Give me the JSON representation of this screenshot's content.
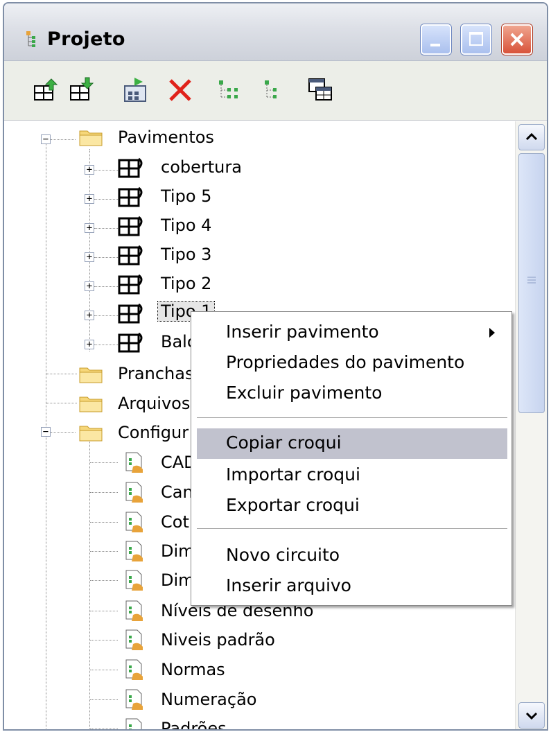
{
  "window": {
    "title": "Projeto",
    "controls": [
      "minimize",
      "maximize",
      "close"
    ]
  },
  "toolbar": {
    "icons": [
      "insert-floor-above-icon",
      "insert-floor-below-icon",
      "properties-icon",
      "delete-icon",
      "expand-tree-icon",
      "collapse-tree-icon",
      "copy-window-icon"
    ]
  },
  "tree": {
    "root_folders": {
      "pavimentos": "Pavimentos",
      "pranchas": "Pranchas",
      "arquivos": "Arquivos",
      "configuracoes": "Configur"
    },
    "floors": [
      "cobertura",
      "Tipo 5",
      "Tipo 4",
      "Tipo 3",
      "Tipo 2",
      "Tipo 1",
      "Balc"
    ],
    "selected": "Tipo 1",
    "config_items": [
      "CAD",
      "Can",
      "Cot",
      "Dim",
      "Dim",
      "Níveis de desenho",
      "Niveis padrão",
      "Normas",
      "Numeração",
      "Padrões"
    ]
  },
  "context_menu": {
    "items": [
      {
        "label": "Inserir pavimento",
        "submenu": true
      },
      {
        "label": "Propriedades do pavimento"
      },
      {
        "label": "Excluir pavimento"
      },
      {
        "label": "Copiar croqui",
        "highlighted": true
      },
      {
        "label": "Importar croqui"
      },
      {
        "label": "Exportar croqui"
      },
      {
        "label": "Novo circuito"
      },
      {
        "label": "Inserir arquivo"
      }
    ]
  },
  "colors": {
    "menu_highlight": "#c1c2ce",
    "close_button": "#d8533a",
    "window_button": "#aac0ee"
  }
}
